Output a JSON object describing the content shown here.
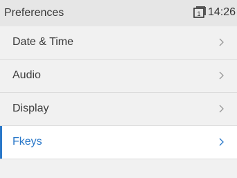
{
  "header": {
    "title": "Preferences",
    "time": "14:26"
  },
  "menu": {
    "items": [
      {
        "label": "Date & Time",
        "selected": false
      },
      {
        "label": "Audio",
        "selected": false
      },
      {
        "label": "Display",
        "selected": false
      },
      {
        "label": "Fkeys",
        "selected": true
      }
    ]
  },
  "colors": {
    "accent": "#2a78c9",
    "background": "#f1f1f1",
    "header_bg": "#e6e6e6"
  },
  "icons": {
    "status": "phone-account-icon",
    "chevron": "chevron-right-icon"
  }
}
